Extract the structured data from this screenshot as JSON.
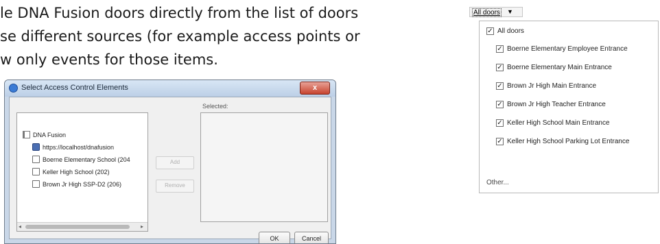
{
  "document": {
    "lines": [
      "le DNA Fusion doors directly from the list of doors",
      "se different sources (for example access points or",
      "w only events for those items."
    ]
  },
  "dialog": {
    "title": "Select Access Control Elements",
    "close_label": "x",
    "tree": [
      {
        "label": "DNA Fusion",
        "icon": "dna-fusion-icon"
      },
      {
        "label": "https://localhost/dnafusion",
        "icon": "server-icon"
      },
      {
        "label": "Boerne Elementary School (204",
        "icon": "door-icon"
      },
      {
        "label": "Keller High School (202)",
        "icon": "door-icon"
      },
      {
        "label": "Brown Jr High SSP-D2 (206)",
        "icon": "door-icon"
      }
    ],
    "add_label": "Add",
    "remove_label": "Remove",
    "selected_label": "Selected:",
    "ok_label": "OK",
    "cancel_label": "Cancel"
  },
  "filter": {
    "header_label": "All doors",
    "all_label": "All doors",
    "items": [
      {
        "label": "Boerne Elementary Employee Entrance",
        "checked": true
      },
      {
        "label": "Boerne Elementary Main Entrance",
        "checked": true
      },
      {
        "label": "Brown Jr High Main Entrance",
        "checked": true
      },
      {
        "label": "Brown Jr High Teacher Entrance",
        "checked": true
      },
      {
        "label": "Keller High School Main Entrance",
        "checked": true
      },
      {
        "label": "Keller High School Parking Lot Entrance",
        "checked": true
      }
    ],
    "other_label": "Other..."
  }
}
